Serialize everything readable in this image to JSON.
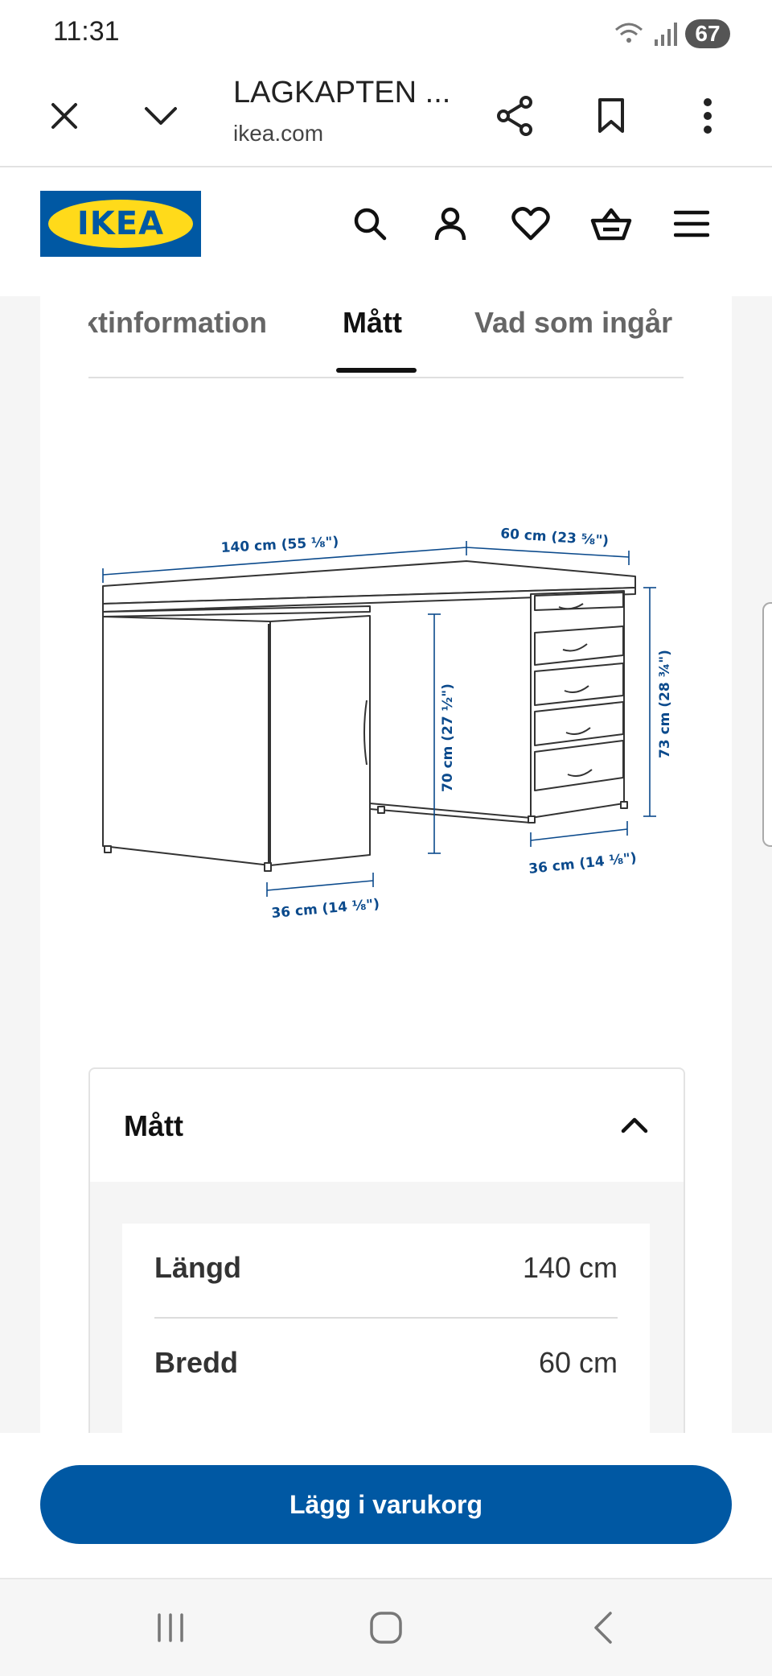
{
  "status_bar": {
    "time": "11:31",
    "battery": "67"
  },
  "browser": {
    "title": "LAGKAPTEN ...",
    "domain": "ikea.com"
  },
  "ikea": {
    "logo_text": "IKEA"
  },
  "tabs": [
    {
      "label": "ktinformation"
    },
    {
      "label": "Mått",
      "selected": true
    },
    {
      "label": "Vad som ingår"
    }
  ],
  "diagram": {
    "dim_length": "140 cm (55 ⅛\")",
    "dim_depth": "60 cm (23 ⅝\")",
    "dim_total_height": "73 cm (28 ¾\")",
    "dim_leg_height": "70 cm (27 ½\")",
    "dim_drawer_width": "36 cm (14 ⅛\")",
    "dim_cabinet_width": "36 cm (14 ⅛\")"
  },
  "accordion": {
    "title": "Mått",
    "rows": [
      {
        "label": "Längd",
        "value": "140 cm"
      },
      {
        "label": "Bredd",
        "value": "60 cm"
      }
    ]
  },
  "cart_button": {
    "label": "Lägg i varukorg"
  },
  "colors": {
    "ikea_blue": "#0058a3",
    "ikea_yellow": "#ffda1a",
    "dimension_blue": "#0b4a8c"
  }
}
